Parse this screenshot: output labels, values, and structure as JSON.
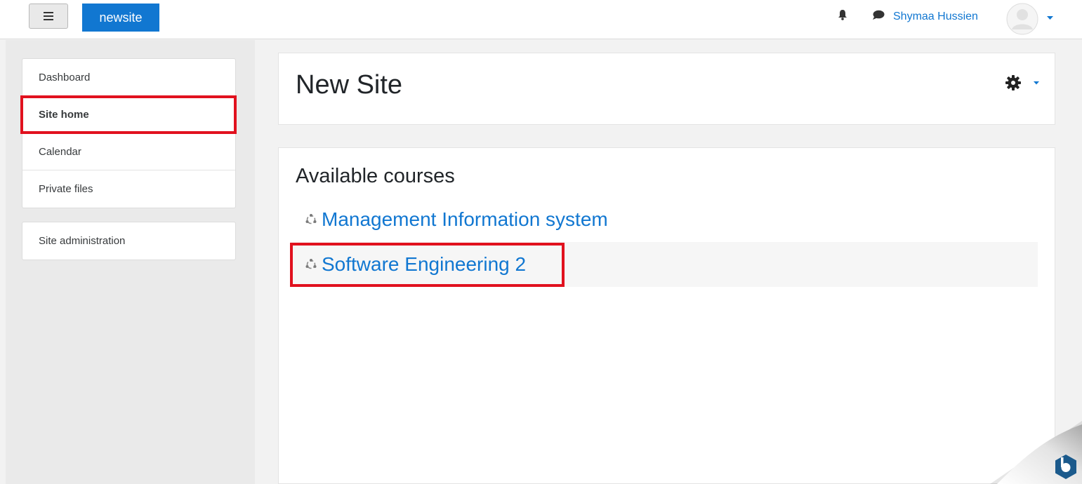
{
  "navbar": {
    "brand": "newsite",
    "user_name": "Shymaa Hussien"
  },
  "drawer": {
    "primary": [
      {
        "label": "Dashboard"
      },
      {
        "label": "Site home",
        "active": true
      },
      {
        "label": "Calendar"
      },
      {
        "label": "Private files"
      }
    ],
    "admin": [
      {
        "label": "Site administration"
      }
    ]
  },
  "main": {
    "page_title": "New Site",
    "courses_heading": "Available courses",
    "courses": [
      {
        "name": "Management Information system"
      },
      {
        "name": "Software Engineering 2"
      }
    ]
  },
  "icons": {
    "menu": "hamburger-icon",
    "notifications": "bell-icon",
    "messages": "chat-bubble-icon",
    "settings": "gear-icon",
    "course": "course-icon"
  },
  "colors": {
    "brand": "#1177d1",
    "link": "#1177d1",
    "highlight": "#e1111e",
    "background": "#f2f2f2"
  }
}
